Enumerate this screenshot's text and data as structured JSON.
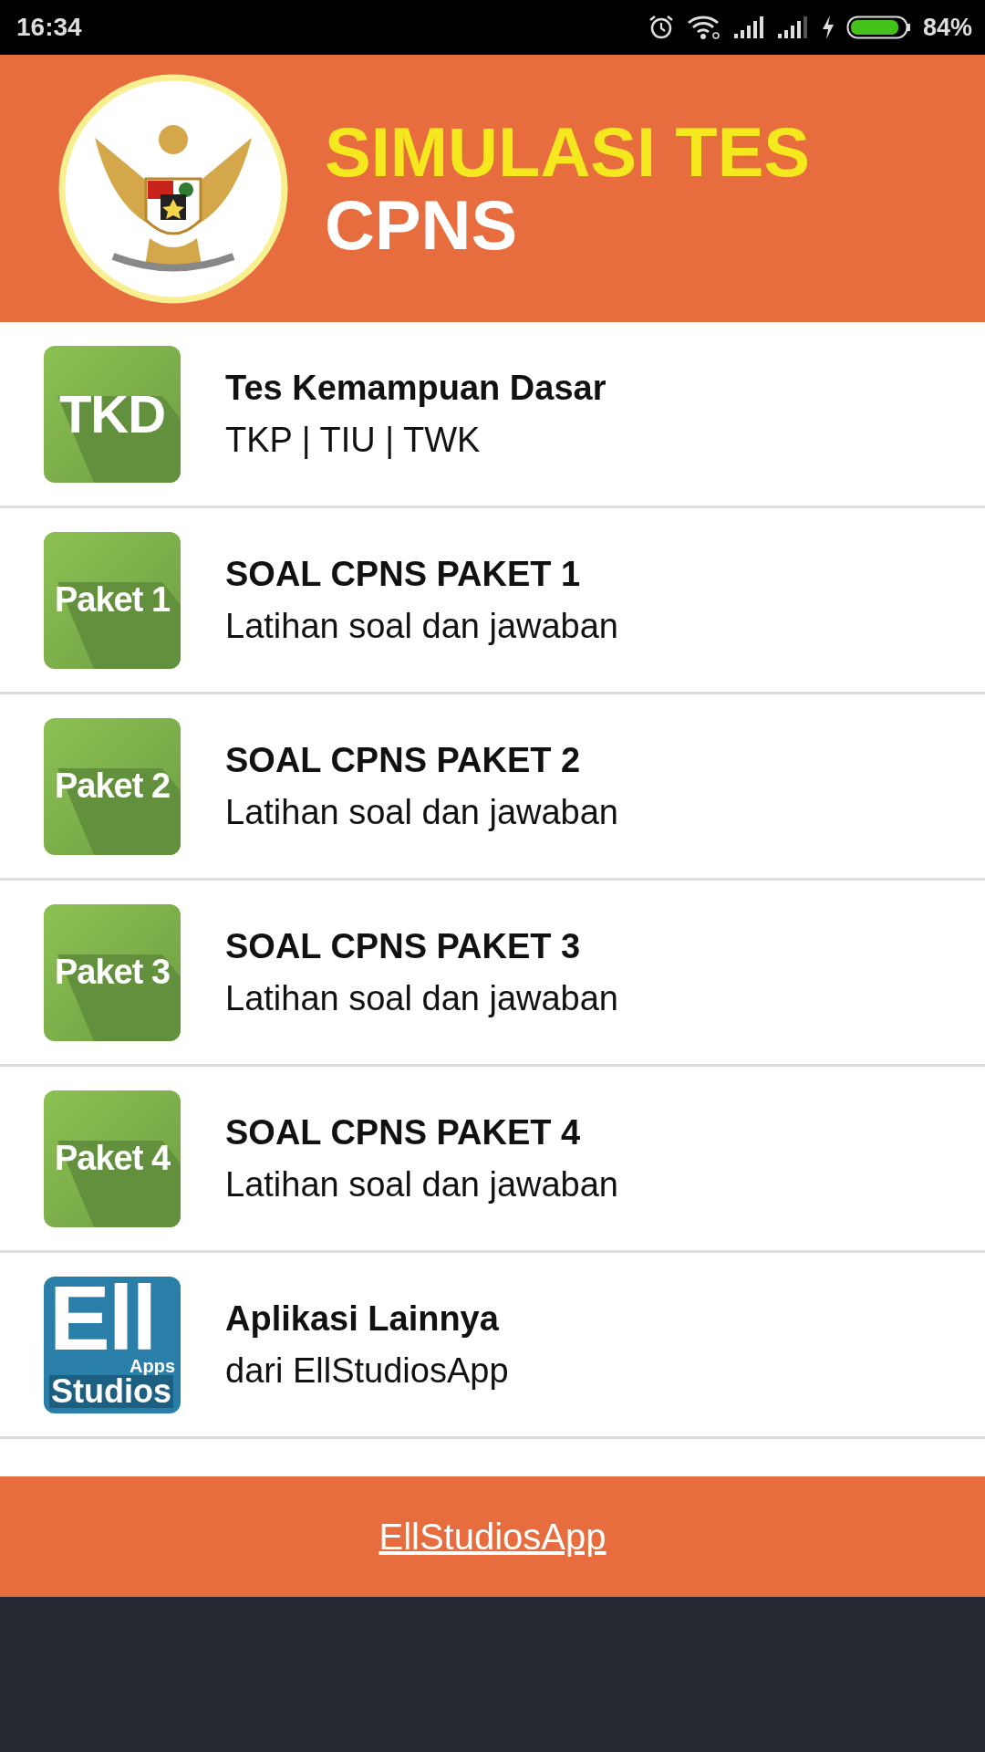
{
  "status_bar": {
    "time": "16:34",
    "battery": "84%"
  },
  "header": {
    "title_line_1": "SIMULASI TES",
    "title_line_2": "CPNS"
  },
  "menu": [
    {
      "kind": "tile",
      "icon_text": "TKD",
      "title": "Tes Kemampuan Dasar",
      "subtitle": "TKP | TIU | TWK"
    },
    {
      "kind": "tile",
      "icon_text": "Paket 1",
      "title": "SOAL CPNS PAKET 1",
      "subtitle": "Latihan soal dan jawaban"
    },
    {
      "kind": "tile",
      "icon_text": "Paket 2",
      "title": "SOAL CPNS PAKET 2",
      "subtitle": "Latihan soal dan jawaban"
    },
    {
      "kind": "tile",
      "icon_text": "Paket 3",
      "title": "SOAL CPNS PAKET 3",
      "subtitle": "Latihan soal dan jawaban"
    },
    {
      "kind": "tile",
      "icon_text": "Paket 4",
      "title": "SOAL CPNS PAKET 4",
      "subtitle": "Latihan soal dan jawaban"
    },
    {
      "kind": "logo",
      "icon_lines": [
        "Ell",
        "Apps",
        "Studios"
      ],
      "title": "Aplikasi Lainnya",
      "subtitle": "dari EllStudiosApp"
    }
  ],
  "footer": {
    "link": "EllStudiosApp"
  }
}
